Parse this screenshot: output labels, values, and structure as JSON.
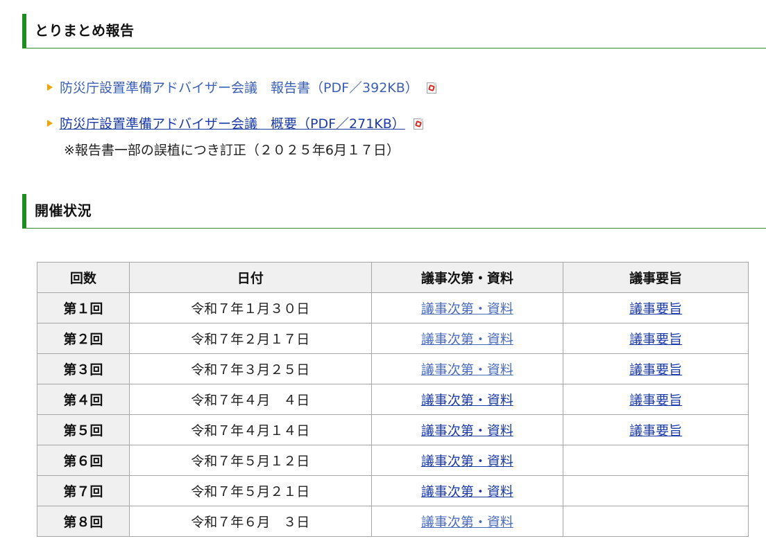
{
  "sections": {
    "summary_title": "とりまとめ報告",
    "meetings_title": "開催状況"
  },
  "documents": [
    {
      "label": "防災庁設置準備アドバイザー会議　報告書（PDF／392KB）",
      "icon": "pdf-icon"
    },
    {
      "label": "防災庁設置準備アドバイザー会議　概要（PDF／271KB）",
      "icon": "pdf-icon"
    }
  ],
  "document_note": "※報告書一部の誤植につき訂正（２０２５年6月１７日）",
  "table": {
    "headers": [
      "回数",
      "日付",
      "議事次第・資料",
      "議事要旨"
    ],
    "rows": [
      {
        "round": "第１回",
        "date": "令和７年１月３０日",
        "agenda": "議事次第・資料",
        "summary": "議事要旨"
      },
      {
        "round": "第２回",
        "date": "令和７年２月１７日",
        "agenda": "議事次第・資料",
        "summary": "議事要旨"
      },
      {
        "round": "第３回",
        "date": "令和７年３月２５日",
        "agenda": "議事次第・資料",
        "summary": "議事要旨"
      },
      {
        "round": "第４回",
        "date": "令和７年４月　４日",
        "agenda": "議事次第・資料",
        "summary": "議事要旨"
      },
      {
        "round": "第５回",
        "date": "令和７年４月１４日",
        "agenda": "議事次第・資料",
        "summary": "議事要旨"
      },
      {
        "round": "第６回",
        "date": "令和７年５月１２日",
        "agenda": "議事次第・資料",
        "summary": ""
      },
      {
        "round": "第７回",
        "date": "令和７年５月２１日",
        "agenda": "議事次第・資料",
        "summary": ""
      },
      {
        "round": "第８回",
        "date": "令和７年６月　３日",
        "agenda": "議事次第・資料",
        "summary": ""
      }
    ]
  },
  "colors": {
    "heading_accent": "#1e8c1e",
    "bullet": "#e8a317",
    "link": "#1a3aa8",
    "visited_link": "#4a6bc0",
    "header_bg": "#f0f0f0"
  }
}
